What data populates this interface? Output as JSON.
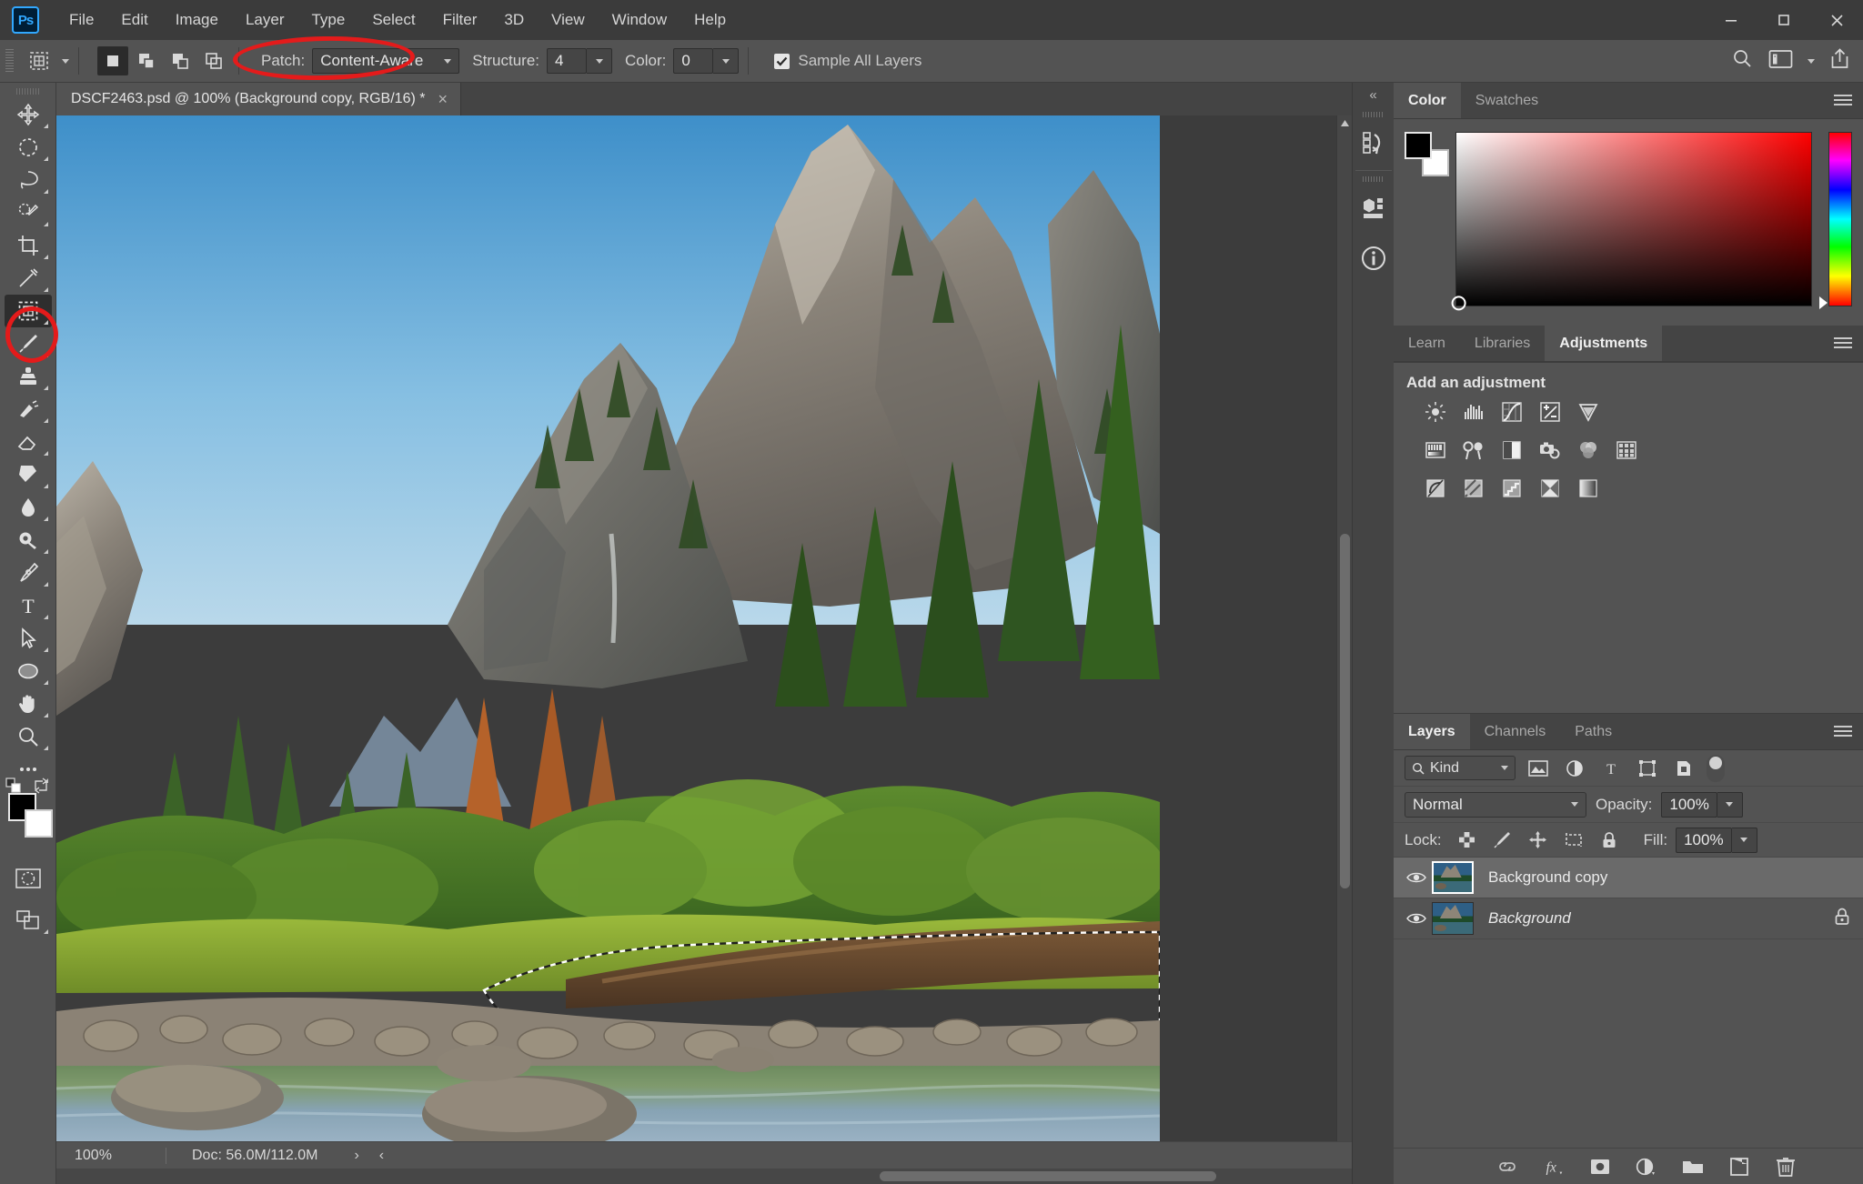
{
  "app": {
    "logo": "Ps",
    "window_controls": {
      "minimize": "minimize-icon",
      "maximize": "maximize-icon",
      "close": "close-icon"
    }
  },
  "menu": {
    "items": [
      "File",
      "Edit",
      "Image",
      "Layer",
      "Type",
      "Select",
      "Filter",
      "3D",
      "View",
      "Window",
      "Help"
    ]
  },
  "options_bar": {
    "tool_preset_icon": "patch-tool-icon",
    "mode_buttons": [
      "new-selection",
      "add-to-selection",
      "subtract-from-selection",
      "intersect-with-selection"
    ],
    "patch_label": "Patch:",
    "patch_value": "Content-Aware",
    "structure_label": "Structure:",
    "structure_value": "4",
    "color_label": "Color:",
    "color_value": "0",
    "sample_all_layers_label": "Sample All Layers",
    "sample_all_layers_checked": true,
    "right_icons": [
      "search-icon",
      "workspace-icon",
      "chevron-down-icon",
      "share-icon"
    ]
  },
  "toolbar": {
    "tools": [
      {
        "name": "move-tool",
        "selected": false
      },
      {
        "name": "rectangular-marquee-tool",
        "selected": false
      },
      {
        "name": "lasso-tool",
        "selected": false
      },
      {
        "name": "quick-selection-tool",
        "selected": false
      },
      {
        "name": "crop-tool",
        "selected": false
      },
      {
        "name": "eyedropper-tool",
        "selected": false
      },
      {
        "name": "patch-tool",
        "selected": true
      },
      {
        "name": "brush-tool",
        "selected": false
      },
      {
        "name": "clone-stamp-tool",
        "selected": false
      },
      {
        "name": "history-brush-tool",
        "selected": false
      },
      {
        "name": "eraser-tool",
        "selected": false
      },
      {
        "name": "gradient-tool",
        "selected": false
      },
      {
        "name": "blur-tool",
        "selected": false
      },
      {
        "name": "dodge-tool",
        "selected": false
      },
      {
        "name": "pen-tool",
        "selected": false
      },
      {
        "name": "horizontal-type-tool",
        "selected": false
      },
      {
        "name": "path-selection-tool",
        "selected": false
      },
      {
        "name": "ellipse-tool",
        "selected": false
      },
      {
        "name": "hand-tool",
        "selected": false
      },
      {
        "name": "zoom-tool",
        "selected": false
      },
      {
        "name": "edit-toolbar-tool",
        "selected": false
      }
    ],
    "foreground_color": "#000000",
    "background_color": "#ffffff",
    "quick_mask": "quick-mask-icon",
    "screen_mode": "screen-mode-icon"
  },
  "document": {
    "tab_title": "DSCF2463.psd @ 100% (Background copy, RGB/16) *",
    "close_label": "×"
  },
  "status_bar": {
    "zoom": "100%",
    "doc": "Doc: 56.0M/112.0M",
    "arrow_right": "›",
    "arrow_left": "‹"
  },
  "dock_strip": {
    "collapse": "«",
    "buttons": [
      "history-icon",
      "properties-icon",
      "info-icon"
    ]
  },
  "color_panel": {
    "tabs": [
      {
        "label": "Color",
        "active": true
      },
      {
        "label": "Swatches",
        "active": false
      }
    ],
    "menu_icon": "panel-menu-icon",
    "foreground": "#000000",
    "background": "#ffffff",
    "hue": "#ff0000"
  },
  "adjustments_panel": {
    "tabs": [
      {
        "label": "Learn",
        "active": false
      },
      {
        "label": "Libraries",
        "active": false
      },
      {
        "label": "Adjustments",
        "active": true
      }
    ],
    "menu_icon": "panel-menu-icon",
    "title": "Add an adjustment",
    "rows": [
      [
        "brightness-contrast-icon",
        "levels-icon",
        "curves-icon",
        "exposure-icon",
        "vibrance-icon"
      ],
      [
        "hue-saturation-icon",
        "color-balance-icon",
        "black-and-white-icon",
        "photo-filter-icon",
        "channel-mixer-icon",
        "color-lookup-icon"
      ],
      [
        "invert-icon",
        "posterize-icon",
        "threshold-icon",
        "gradient-map-icon",
        "selective-color-icon"
      ]
    ]
  },
  "layers_panel": {
    "tabs": [
      {
        "label": "Layers",
        "active": true
      },
      {
        "label": "Channels",
        "active": false
      },
      {
        "label": "Paths",
        "active": false
      }
    ],
    "menu_icon": "panel-menu-icon",
    "filter": {
      "kind_label": "Kind",
      "search_icon": "search-icon",
      "filter_icons": [
        "filter-pixel-icon",
        "filter-adjustment-icon",
        "filter-type-icon",
        "filter-shape-icon",
        "filter-smart-object-icon"
      ],
      "toggle": "filter-toggle"
    },
    "blend_mode": "Normal",
    "opacity_label": "Opacity:",
    "opacity_value": "100%",
    "lock_label": "Lock:",
    "lock_icons": [
      "lock-transparent-pixels-icon",
      "lock-image-pixels-icon",
      "lock-position-icon",
      "lock-artboard-nesting-icon",
      "lock-all-icon"
    ],
    "fill_label": "Fill:",
    "fill_value": "100%",
    "layers": [
      {
        "name": "Background copy",
        "selected": true,
        "visible": true,
        "locked": false,
        "italic": false
      },
      {
        "name": "Background",
        "selected": false,
        "visible": true,
        "locked": true,
        "italic": true
      }
    ],
    "footer_buttons": [
      "link-layers-icon",
      "add-layer-style-icon",
      "add-layer-mask-icon",
      "new-fill-adjustment-icon",
      "new-group-icon",
      "new-layer-icon",
      "delete-layer-icon"
    ]
  },
  "annotations": {
    "accent_color": "#e41b1b",
    "highlights": [
      "patch-mode-dropdown-highlight",
      "patch-tool-highlight"
    ]
  }
}
